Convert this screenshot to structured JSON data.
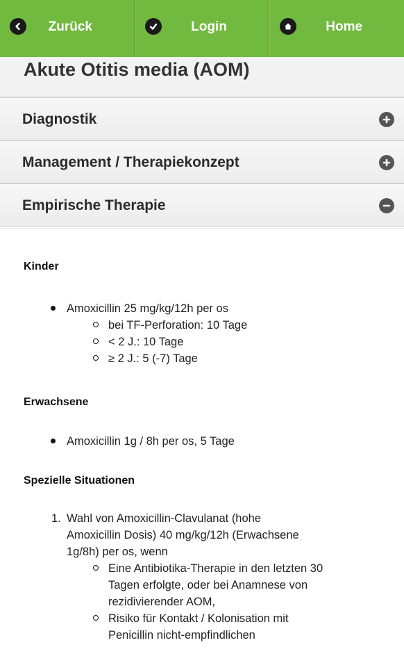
{
  "nav": {
    "back_label": "Zurück",
    "login_label": "Login",
    "home_label": "Home",
    "back_icon": "chevron-left-icon",
    "login_icon": "check-icon",
    "home_icon": "home-icon"
  },
  "page": {
    "title": "Akute Otitis media (AOM)"
  },
  "sections": [
    {
      "title": "Diagnostik",
      "icon": "plus-icon"
    },
    {
      "title": "Management / Therapiekonzept",
      "icon": "plus-icon"
    },
    {
      "title": "Empirische Therapie",
      "icon": "minus-icon"
    }
  ],
  "content": {
    "kinder": {
      "heading": "Kinder",
      "item": "Amoxicillin 25 mg/kg/12h per os",
      "sub": [
        "bei TF-Perforation: 10 Tage",
        "< 2 J.: 10 Tage",
        "≥ 2 J.: 5 (-7) Tage"
      ]
    },
    "erwachsene": {
      "heading": "Erwachsene",
      "item": "Amoxicillin 1g / 8h per os, 5 Tage"
    },
    "spezielle": {
      "heading": "Spezielle Situationen",
      "number": "1.",
      "item_lines": [
        "Wahl von Amoxicillin-Clavulanat (hohe",
        "Amoxicillin Dosis) 40 mg/kg/12h (Erwachsene",
        "1g/8h) per os, wenn"
      ],
      "sub1_lines": [
        "Eine Antibiotika-Therapie in den letzten 30",
        "Tagen erfolgte, oder bei Anamnese von",
        "rezidivierender AOM,"
      ],
      "sub2_lines": [
        "Risiko für Kontakt / Kolonisation mit",
        "Penicillin nicht-empfindlichen"
      ]
    }
  },
  "colors": {
    "nav_green": "#72b93f",
    "icon_dark": "#555555"
  }
}
